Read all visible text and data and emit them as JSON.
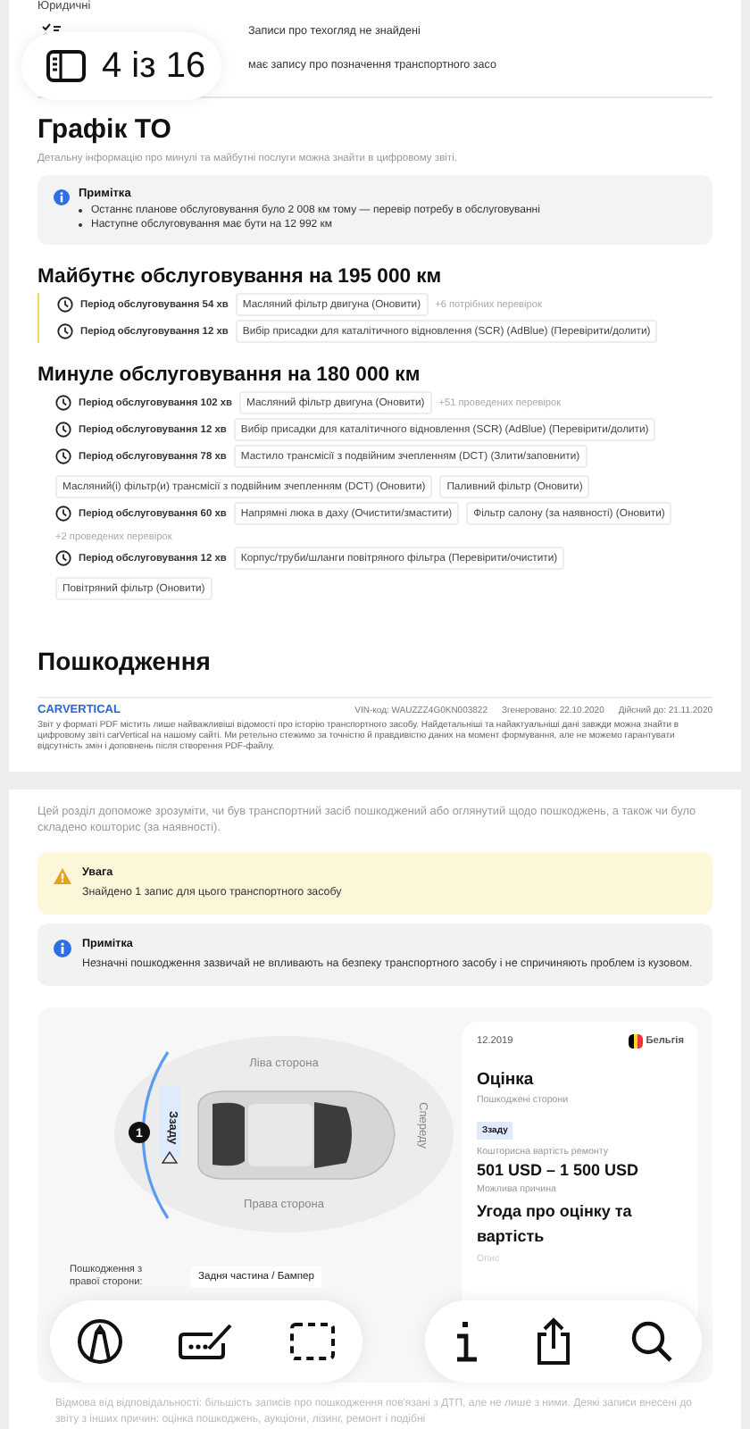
{
  "page_indicator": {
    "text": "4 із 16"
  },
  "legal": {
    "heading": "Юридичні",
    "rows": [
      {
        "text": "Записи про техогляд не знайдені"
      },
      {
        "text": "має запису про позначення транспортного засо"
      }
    ]
  },
  "maintenance": {
    "title": "Графік ТО",
    "subtitle": "Детальну інформацію про минулі та майбутні послуги можна знайти в цифровому звіті.",
    "note": {
      "title": "Примітка",
      "bullets": [
        "Останнє планове обслуговування було 2 008 км тому — перевір потребу в обслуговуванні",
        "Наступне обслуговування має бути на 12 992 км"
      ]
    },
    "groups": [
      {
        "kind": "future",
        "title": "Майбутнє обслуговування на 195 000 км",
        "entries": [
          {
            "period": "Період обслуговування 54 хв",
            "tags": [
              "Масляний фільтр двигуна (Оновити)"
            ],
            "more": "+6 потрібних перевірок"
          },
          {
            "period": "Період обслуговування 12 хв",
            "tags": [
              "Вибір присадки для каталітичного відновлення (SCR) (AdBlue) (Перевірити/долити)"
            ]
          }
        ]
      },
      {
        "kind": "past",
        "title": "Минуле обслуговування на 180 000 км",
        "entries": [
          {
            "period": "Період обслуговування 102 хв",
            "tags": [
              "Масляний фільтр двигуна (Оновити)"
            ],
            "more": "+51 проведених перевірок"
          },
          {
            "period": "Період обслуговування 12 хв",
            "tags": [
              "Вибір присадки для каталітичного відновлення (SCR) (AdBlue) (Перевірити/долити)"
            ]
          },
          {
            "period": "Період обслуговування 78 хв",
            "tags": [
              "Мастило трансмісії з подвійним зчепленням (DCT) (Злити/заповнити)",
              "Масляний(і) фільтр(и) трансмісії з подвійним зчепленням (DCT) (Оновити)",
              "Паливний фільтр (Оновити)"
            ]
          },
          {
            "period": "Період обслуговування 60 хв",
            "tags": [
              "Напрямні люка в даху (Очистити/змастити)",
              "Фільтр салону (за наявності) (Оновити)"
            ],
            "more": "+2 проведених перевірок"
          },
          {
            "period": "Період обслуговування 12 хв",
            "tags": [
              "Корпус/труби/шланги повітряного фільтра (Перевірити/очистити)",
              "Повітряний фільтр (Оновити)"
            ]
          }
        ]
      }
    ]
  },
  "damage_heading": "Пошкодження",
  "footer": {
    "logo": "CARVERTICAL",
    "vin": "VIN-код: WAUZZZ4G0KN003822",
    "generated": "Згенеровано: 22.10.2020",
    "valid": "Дійсний до: 21.11.2020",
    "disclaimer": "Звіт у форматі PDF містить лише найважливіші відомості про історію транспортного засобу. Найдетальніші та найактуальніші дані завжди можна знайти в цифровому звіті carVertical на нашому сайті. Ми ретельно стежимо за точністю й правдивістю даних на момент формування, але не можемо гарантувати відсутність змін і доповнень після створення PDF-файлу."
  },
  "damage": {
    "intro": "Цей розділ допоможе зрозуміти, чи був транспортний засіб пошкоджений або оглянутий щодо пошкоджень, а також чи було складено кошторис (за наявності).",
    "alerts": [
      {
        "kind": "warning",
        "title": "Увага",
        "text": "Знайдено 1 запис для цього транспортного засобу"
      },
      {
        "kind": "info",
        "title": "Примітка",
        "text": "Незначні пошкодження зазвичай не впливають на безпеку транспортного засобу і не спричиняють проблем із кузовом."
      }
    ],
    "diagram": {
      "left": "Ліва сторона",
      "right": "Права сторона",
      "front": "Спереду",
      "rear": "Ззаду",
      "count": "1"
    },
    "side_label": "Пошкодження з правої сторони:",
    "side_value": "Задня частина / Бампер",
    "card": {
      "date": "12.2019",
      "country": "Бельгія",
      "title": "Оцінка",
      "sides_label": "Пошкоджені сторони",
      "sides_tag": "Ззаду",
      "cost_label": "Кошторисна вартість ремонту",
      "cost": "501 USD – 1 500 USD",
      "cause_label": "Можлива причина",
      "cause": "Угода про оцінку та вартість",
      "desc_label": "Опис"
    },
    "disclaimer": "Відмова від відповідальності: більшість записів про пошкодження пов'язані з ДТП, але не лише з ними. Деякі записи внесені до звіту з інших причин: оцінка пошкоджень, аукціони, лізинг, ремонт і подібні"
  }
}
